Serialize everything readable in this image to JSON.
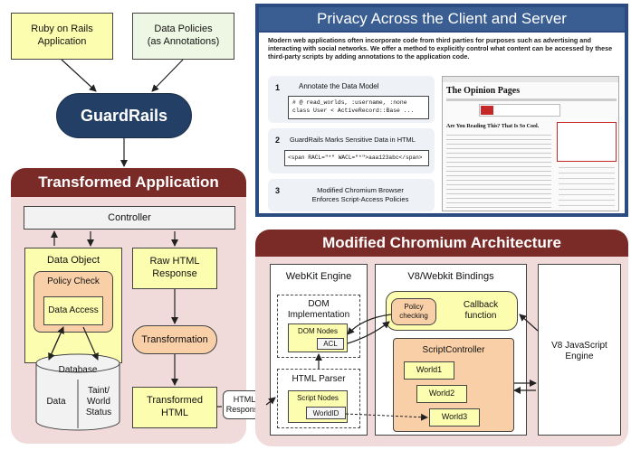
{
  "left": {
    "rails_app": "Ruby on Rails\nApplication",
    "data_policies": "Data Policies\n(as Annotations)",
    "guardrails": "GuardRails",
    "transformed_app_title": "Transformed Application",
    "controller": "Controller",
    "data_object": "Data Object",
    "policy_check": "Policy Check",
    "data_access": "Data Access",
    "raw_html": "Raw HTML\nResponse",
    "transformation": "Transformation",
    "database": "Database",
    "db_data": "Data",
    "db_taint": "Taint/\nWorld\nStatus",
    "transformed_html": "Transformed\nHTML",
    "html_response": "HTML\nResponse"
  },
  "privacy": {
    "title": "Privacy Across the Client and Server",
    "intro": "Modern web applications often incorporate code from third parties for purposes such as advertising and interacting with social networks.  We offer a method to explicitly control what content can be accessed by these third-party scripts by adding annotations to the application code.",
    "steps": [
      {
        "num": "1",
        "text": "Annotate the Data Model"
      },
      {
        "num": "2",
        "text": "GuardRails Marks Sensitive Data in HTML"
      },
      {
        "num": "3",
        "text": "Modified Chromium Browser\nEnforces Script-Access Policies"
      }
    ],
    "code1_line1": "# @ read_worlds, :username, :none",
    "code1_line2": "class  User < ActiveRecord::Base ...",
    "code2": "<span RACL=\"*\" WACL=\"*\">aaa123abc</span>",
    "shot_heading": "The Opinion Pages",
    "shot_article": "Are You Reading This? That Is So Cool."
  },
  "chromium": {
    "title": "Modified Chromium Architecture",
    "webkit_engine": "WebKit Engine",
    "dom_impl": "DOM\nImplementation",
    "dom_nodes": "DOM Nodes",
    "acl": "ACL",
    "html_parser": "HTML Parser",
    "script_nodes": "Script Nodes",
    "world_id": "WorldID",
    "bindings": "V8/Webkit Bindings",
    "policy_checking": "Policy\nchecking",
    "callback": "Callback\nfunction",
    "script_controller": "ScriptController",
    "world1": "World1",
    "world2": "World2",
    "world3": "World3",
    "v8_engine": "V8 JavaScript\nEngine"
  },
  "colors": {
    "accent_dark": "#7a2a27",
    "navy": "#233f66",
    "panel_blue": "#2b4c80"
  }
}
